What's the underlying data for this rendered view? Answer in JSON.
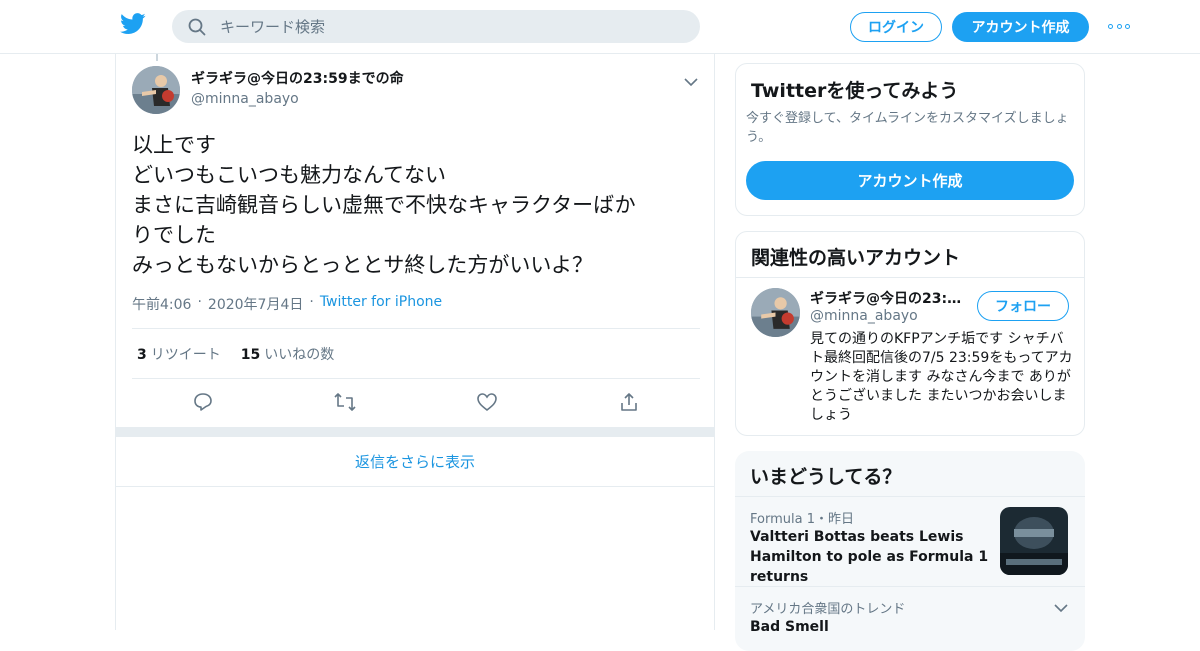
{
  "header": {
    "search_placeholder": "キーワード検索",
    "login_label": "ログイン",
    "signup_label": "アカウント作成",
    "brand_color": "#1da1f2"
  },
  "tweet": {
    "author_name": "ギラギラ@今日の23:59までの命",
    "author_handle": "@minna_abayo",
    "text_lines": [
      "以上です",
      "どいつもこいつも魅力なんてない",
      "まさに吉崎観音らしい虚無で不快なキャラクターばか",
      "りでした",
      "みっともないからとっととサ終した方がいいよ？"
    ],
    "time": "午前4:06",
    "date": "2020年7月4日",
    "source": "Twitter for iPhone",
    "retweet_count": "3",
    "retweet_label": "リツイート",
    "like_count": "15",
    "like_label": "いいねの数",
    "show_more_replies": "返信をさらに表示"
  },
  "signup_card": {
    "title": "Twitterを使ってみよう",
    "subtitle": "今すぐ登録して、タイムラインをカスタマイズしましょう。",
    "cta_label": "アカウント作成"
  },
  "related_card": {
    "title": "関連性の高いアカウント",
    "account_name": "ギラギラ@今日の23:…",
    "account_handle": "@minna_abayo",
    "follow_label": "フォロー",
    "bio": "見ての通りのKFPアンチ垢です シャチバト最終回配信後の7/5 23:59をもってアカウントを消します みなさん今まで ありがとうございました またいつかお会いしましょう"
  },
  "trends_card": {
    "title": "いまどうしてる？",
    "items": [
      {
        "context": "Formula 1・昨日",
        "title": "Valtteri Bottas beats Lewis Hamilton to pole as Formula 1 returns"
      },
      {
        "context": "アメリカ合衆国のトレンド",
        "title": "Bad Smell"
      }
    ]
  }
}
